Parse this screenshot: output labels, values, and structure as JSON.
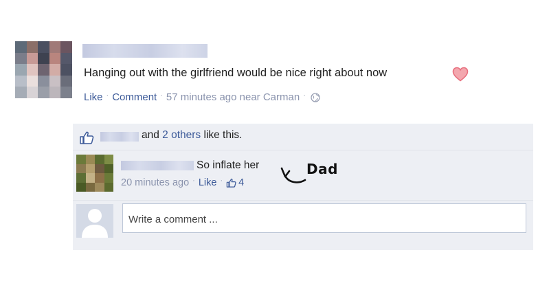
{
  "post": {
    "text": "Hanging out with the girlfriend would be nice right about now",
    "heart_color": "#e8707f",
    "like_label": "Like",
    "comment_label": "Comment",
    "timestamp": "57 minutes ago near Carman",
    "globe_icon": "globe-icon"
  },
  "likes": {
    "text_prefix": "and ",
    "others_link": "2 others",
    "text_suffix": " like this."
  },
  "comment": {
    "text": "So inflate her",
    "timestamp": "20 minutes ago",
    "like_label": "Like",
    "like_count": "4",
    "annotation": "Dad"
  },
  "write_comment": {
    "placeholder": "Write a comment ..."
  },
  "colors": {
    "link": "#3b5998",
    "meta": "#8a93ad",
    "panel": "#edeff4"
  }
}
